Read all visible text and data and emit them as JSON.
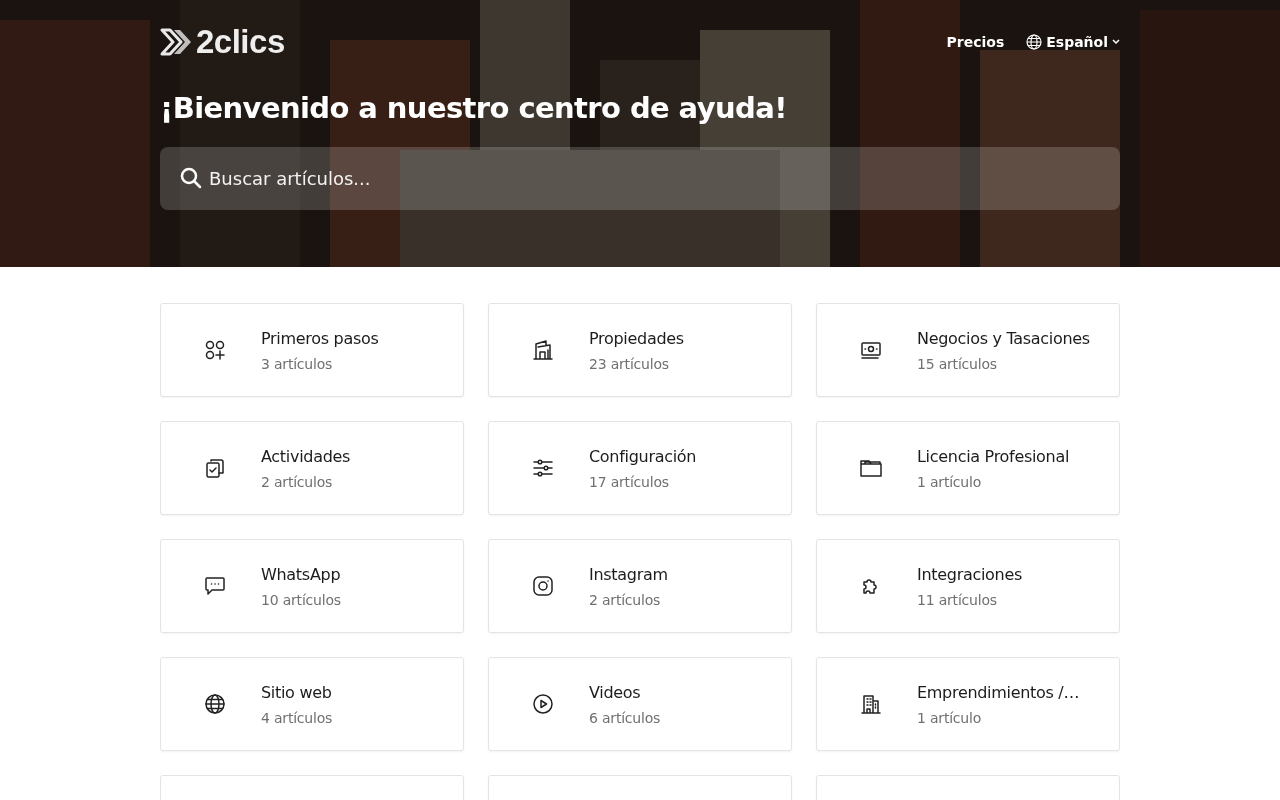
{
  "header": {
    "logo": "2clics",
    "nav": [
      {
        "kind": "link",
        "label": "Precios"
      },
      {
        "kind": "language",
        "label": "Español"
      }
    ]
  },
  "hero": {
    "title": "¡Bienvenido a nuestro centro de ayuda!",
    "search": {
      "placeholder": "Buscar artículos..."
    }
  },
  "categories": [
    {
      "kind": "card",
      "title": "Primeros pasos",
      "count": "3 artículos"
    },
    {
      "kind": "card",
      "title": "Propiedades",
      "count": "23 artículos"
    },
    {
      "kind": "card",
      "title": "Negocios y Tasaciones",
      "count": "15 artículos"
    },
    {
      "kind": "card",
      "title": "Actividades",
      "count": "2 artículos"
    },
    {
      "kind": "card",
      "title": "Configuración",
      "count": "17 artículos"
    },
    {
      "kind": "card",
      "title": "Licencia Profesional",
      "count": "1 artículo"
    },
    {
      "kind": "card",
      "title": "WhatsApp",
      "count": "10 artículos"
    },
    {
      "kind": "card",
      "title": "Instagram",
      "count": "2 artículos"
    },
    {
      "kind": "card",
      "title": "Integraciones",
      "count": "11 artículos"
    },
    {
      "kind": "card",
      "title": "Sitio web",
      "count": "4 artículos"
    },
    {
      "kind": "card",
      "title": "Videos",
      "count": "6 artículos"
    },
    {
      "kind": "card",
      "title": "Emprendimientos /…",
      "count": "1 artículo"
    },
    {
      "kind": "cut"
    },
    {
      "kind": "cut"
    },
    {
      "kind": "cut"
    }
  ]
}
